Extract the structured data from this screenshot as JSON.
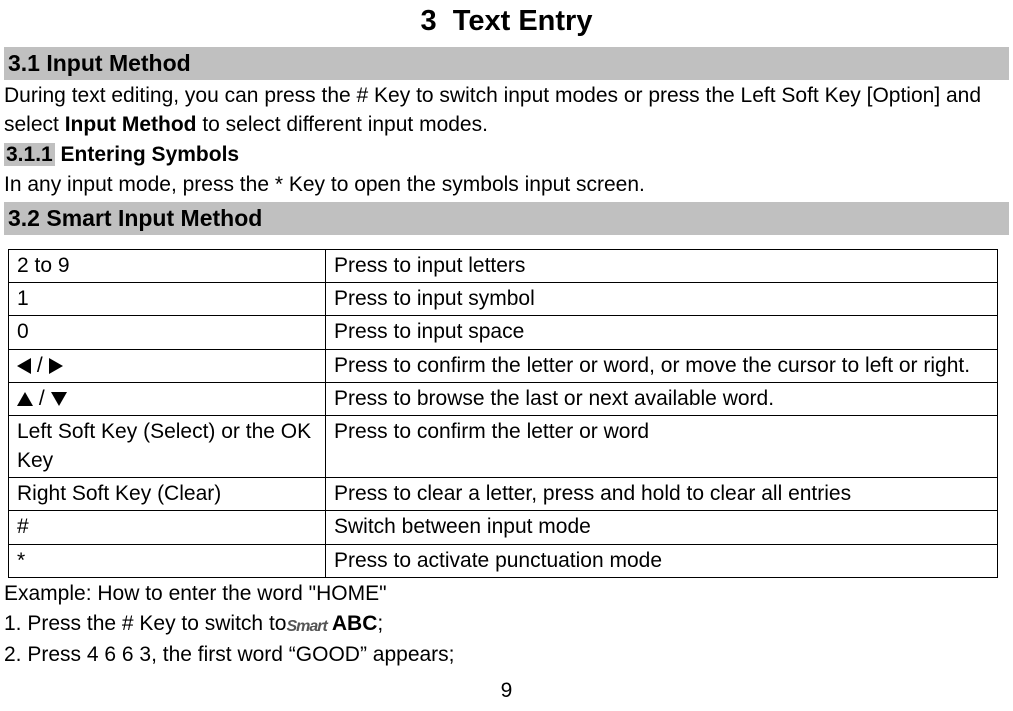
{
  "chapter": {
    "number": "3",
    "title": "Text Entry"
  },
  "section31": {
    "heading": "3.1 Input Method",
    "para_a": "During text editing, you can press the # Key to switch input modes or press the Left Soft Key [Option] and select ",
    "para_b_bold": "Input Method",
    "para_c": " to select different input modes.",
    "sub311_num": "3.1.1",
    "sub311_title": " Entering Symbols",
    "sub311_para": "In any input mode, press the * Key to open the symbols input screen."
  },
  "section32": {
    "heading": "3.2 Smart Input Method",
    "rows": [
      {
        "key": "2 to 9",
        "desc": "Press to input letters"
      },
      {
        "key": "1",
        "desc": "Press to input symbol"
      },
      {
        "key": "0",
        "desc": "Press to input space"
      },
      {
        "key": "LR",
        "desc": "Press to confirm the letter or word, or move the cursor to left or right."
      },
      {
        "key": "UD",
        "desc": "Press to browse the last or next available word."
      },
      {
        "key": "Left Soft Key (Select) or the OK Key",
        "desc": "Press to confirm the letter or word"
      },
      {
        "key": "Right Soft Key (Clear)",
        "desc": "Press to clear a letter, press and hold to clear all entries"
      },
      {
        "key": "#",
        "desc": "Switch between input mode"
      },
      {
        "key": "*",
        "desc": "Press to activate punctuation mode"
      }
    ],
    "example_intro": "Example: How to enter the word \"HOME\"",
    "example_step1_a": "1. Press the # Key to switch to",
    "example_step1_icon": "Smart",
    "example_step1_b": " ABC",
    "example_step1_c": ";",
    "example_step2": "2. Press 4 6 6 3, the first word “GOOD” appears;"
  },
  "page_number": "9"
}
